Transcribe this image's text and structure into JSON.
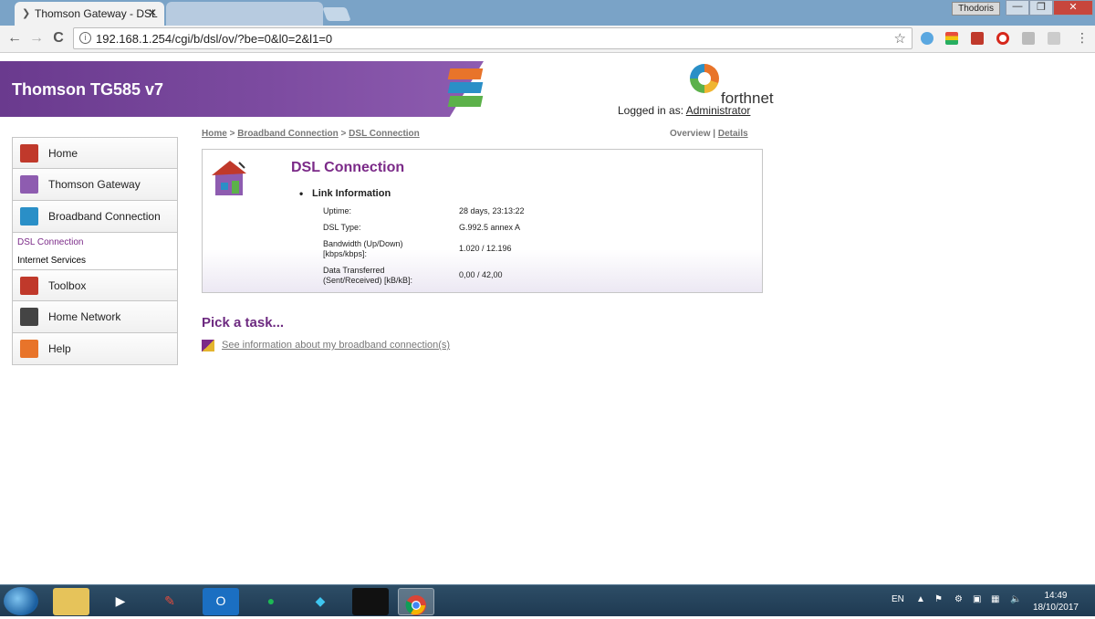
{
  "browser": {
    "tabs": [
      {
        "title": "Thomson Gateway - DSL",
        "close": "✕",
        "active": true
      },
      {
        "title": "",
        "active": false
      }
    ],
    "profile_name": "Thodoris",
    "window_controls": {
      "minimize": "—",
      "maximize": "❐",
      "close": "✕"
    },
    "back": "←",
    "forward": "→",
    "reload": "C",
    "url": "192.168.1.254/cgi/b/dsl/ov/?be=0&l0=2&l1=0",
    "bookmark_icon": "star-icon"
  },
  "router": {
    "model_title": "Thomson TG585 v7",
    "brand": "forthnet",
    "login_label": "Logged in as:",
    "login_user": "Administrator",
    "stripe_colors": [
      "#e8742a",
      "#2a8fc7",
      "#5cb14a"
    ]
  },
  "sidebar": {
    "items": [
      {
        "label": "Home",
        "icon": "house-icon",
        "color": "#c0392b"
      },
      {
        "label": "Thomson Gateway",
        "icon": "gateway-icon",
        "color": "#8e5cb0"
      },
      {
        "label": "Broadband Connection",
        "icon": "broadband-icon",
        "color": "#2a8fc7"
      },
      {
        "label": "Toolbox",
        "icon": "toolbox-icon",
        "color": "#c0392b"
      },
      {
        "label": "Home Network",
        "icon": "home-network-icon",
        "color": "#444"
      },
      {
        "label": "Help",
        "icon": "help-icon",
        "color": "#e8742a"
      }
    ],
    "subitems": [
      {
        "label": "DSL Connection",
        "active": true
      },
      {
        "label": "Internet Services",
        "active": false
      }
    ]
  },
  "breadcrumb": {
    "home": "Home",
    "sep": ">",
    "broadband": "Broadband Connection",
    "current": "DSL Connection"
  },
  "view_links": {
    "overview": "Overview",
    "sep": "|",
    "details": "Details"
  },
  "panel": {
    "title": "DSL Connection",
    "section": "Link Information",
    "rows": [
      {
        "label": "Uptime:",
        "value": "28 days, 23:13:22"
      },
      {
        "label": "DSL Type:",
        "value": "G.992.5 annex A"
      },
      {
        "label": "Bandwidth (Up/Down)\n[kbps/kbps]:",
        "value": "1.020 / 12.196"
      },
      {
        "label": "Data Transferred\n(Sent/Received) [kB/kB]:",
        "value": "0,00 / 42,00"
      }
    ]
  },
  "tasks": {
    "title": "Pick a task...",
    "link": "See information about my broadband connection(s)"
  },
  "taskbar": {
    "language": "EN",
    "time": "14:49",
    "date": "18/10/2017",
    "apps": [
      "explorer-icon",
      "media-player-icon",
      "ccleaner-icon",
      "outlook-icon",
      "spotify-icon",
      "kodi-icon",
      "gopro-icon",
      "chrome-icon"
    ]
  }
}
